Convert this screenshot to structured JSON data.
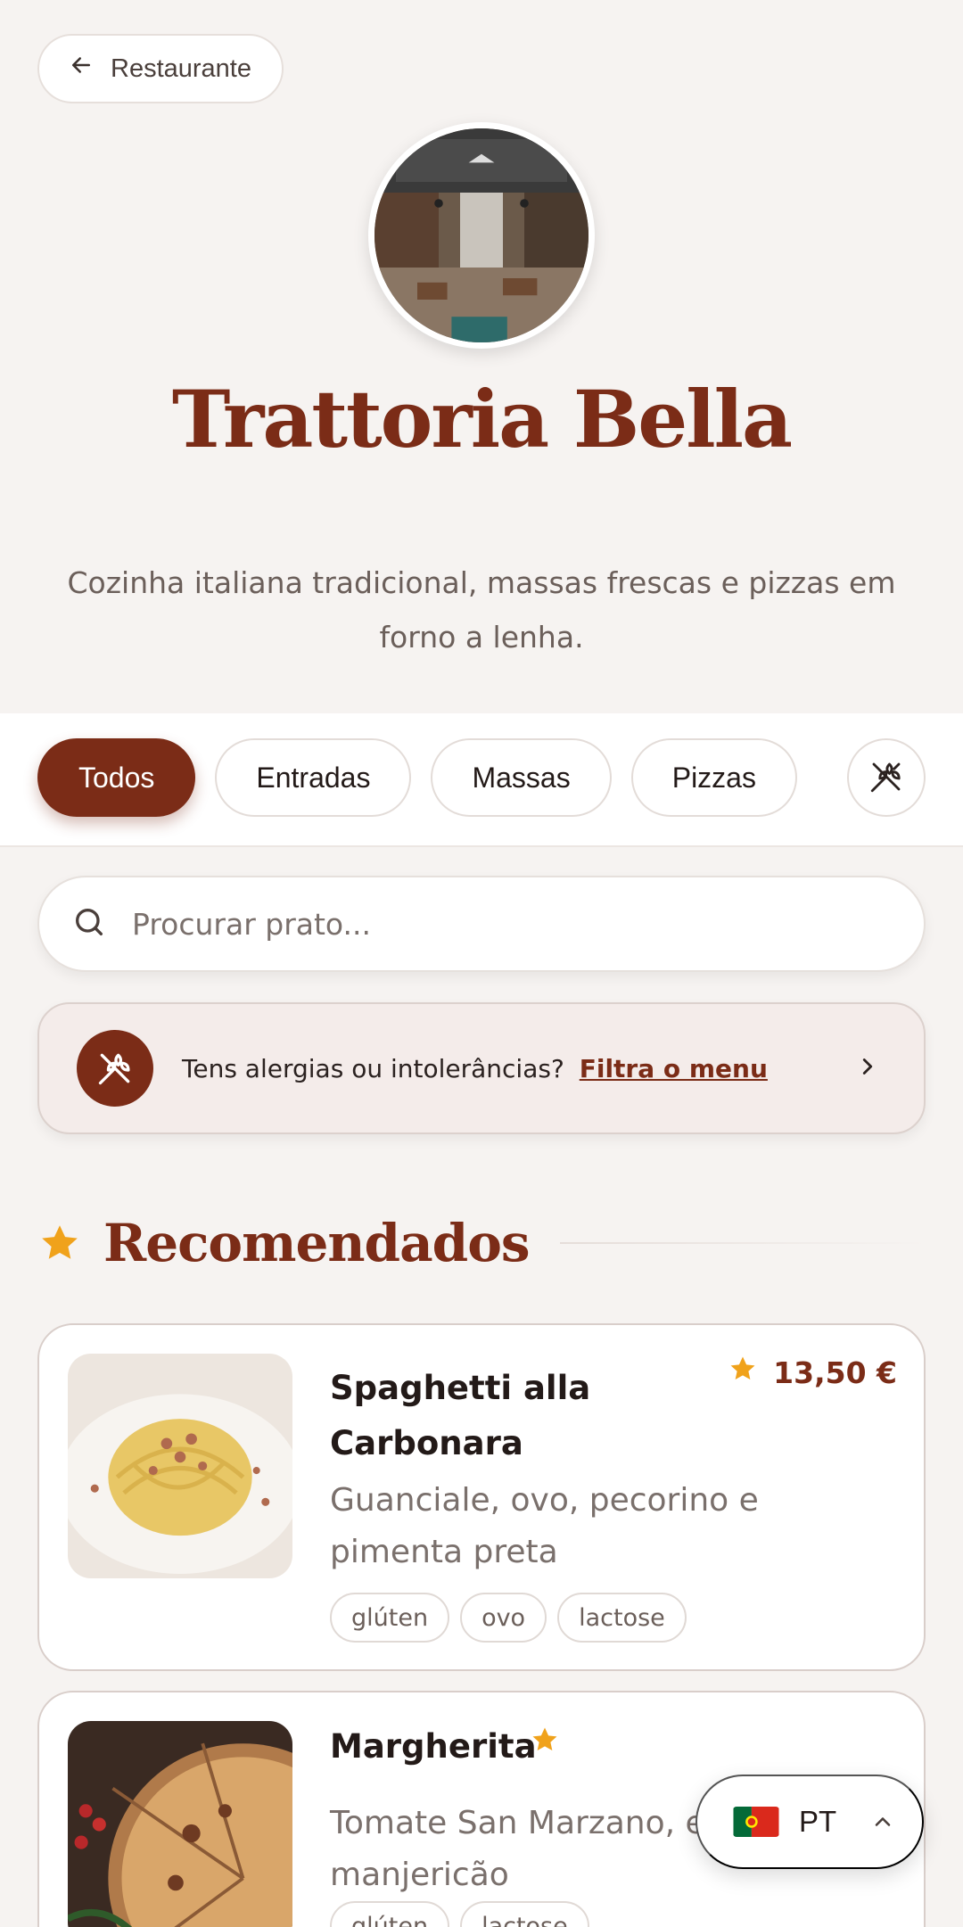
{
  "header": {
    "back_label": "Restaurante",
    "restaurant_name": "Trattoria Bella",
    "description": "Cozinha italiana tradicional, massas frescas e pizzas em forno a lenha."
  },
  "categories": {
    "items": [
      {
        "label": "Todos",
        "active": true
      },
      {
        "label": "Entradas",
        "active": false
      },
      {
        "label": "Massas",
        "active": false
      },
      {
        "label": "Pizzas",
        "active": false
      }
    ],
    "filter_icon": "wheat-icon"
  },
  "search": {
    "placeholder": "Procurar prato...",
    "value": ""
  },
  "allergy_banner": {
    "text": "Tens alergias ou intolerâncias?",
    "link": "Filtra o menu"
  },
  "recommended": {
    "title": "Recomendados",
    "items": [
      {
        "name": "Spaghetti alla Carbonara",
        "price": "13,50 €",
        "description": "Guanciale, ovo, pecorino e pimenta preta",
        "tags": [
          "glúten",
          "ovo",
          "lactose"
        ],
        "featured": true
      },
      {
        "name": "Margherita",
        "price": "",
        "description": "Tomate San Marzano, e manjericão",
        "tags": [
          "glúten",
          "lactose"
        ],
        "featured": true
      }
    ]
  },
  "language": {
    "code": "PT",
    "flag": "portugal-flag-icon"
  },
  "colors": {
    "brand": "#7b2c17",
    "star": "#f0a21b",
    "background": "#f6f3f1"
  }
}
